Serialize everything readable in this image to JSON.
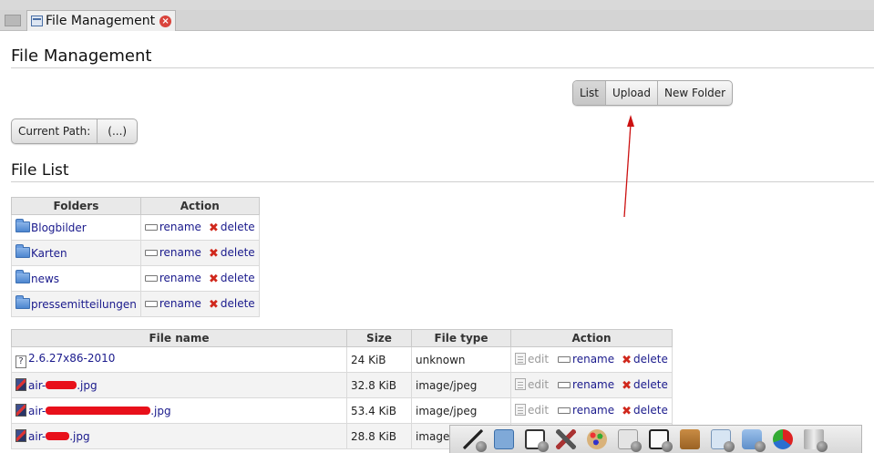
{
  "tab": {
    "title": "File Management"
  },
  "page": {
    "title": "File Management",
    "file_list_title": "File List"
  },
  "nav": {
    "list_label": "List",
    "upload_label": "Upload",
    "new_folder_label": "New Folder"
  },
  "path": {
    "label": "Current Path:",
    "value": "(...)"
  },
  "folders": {
    "headers": [
      "Folders",
      "Action"
    ],
    "rows": [
      {
        "name": "Blogbilder"
      },
      {
        "name": "Karten"
      },
      {
        "name": "news"
      },
      {
        "name": "pressemitteilungen"
      }
    ],
    "rename_label": "rename",
    "delete_label": "delete"
  },
  "files": {
    "headers": [
      "File name",
      "Size",
      "File type",
      "Action"
    ],
    "rows": [
      {
        "name_prefix": "2.6.27x86-2010",
        "name_suffix": "",
        "size": "24 KiB",
        "type": "unknown",
        "icon": "unknown-file-icon"
      },
      {
        "name_prefix": "air-",
        "name_suffix": ".jpg",
        "size": "32.8 KiB",
        "type": "image/jpeg",
        "icon": "image-file-icon"
      },
      {
        "name_prefix": "air-",
        "name_suffix": ".jpg",
        "size": "53.4 KiB",
        "type": "image/jpeg",
        "icon": "image-file-icon"
      },
      {
        "name_prefix": "air-",
        "name_suffix": ".jpg",
        "size": "28.8 KiB",
        "type": "image/jpeg",
        "icon": "image-file-icon"
      }
    ],
    "edit_label": "edit",
    "rename_label": "rename",
    "delete_label": "delete"
  },
  "dock": {
    "icons": [
      "pen-icon",
      "window-icon",
      "screen-icon",
      "tools-icon",
      "palette-icon",
      "image-icon",
      "notepad-icon",
      "package-icon",
      "guestbook-icon",
      "network-icon",
      "chart-icon",
      "trash-icon"
    ]
  },
  "colors": {
    "link": "#1a1a8c",
    "delete": "#d0281c",
    "annotation": "#cc1111"
  }
}
